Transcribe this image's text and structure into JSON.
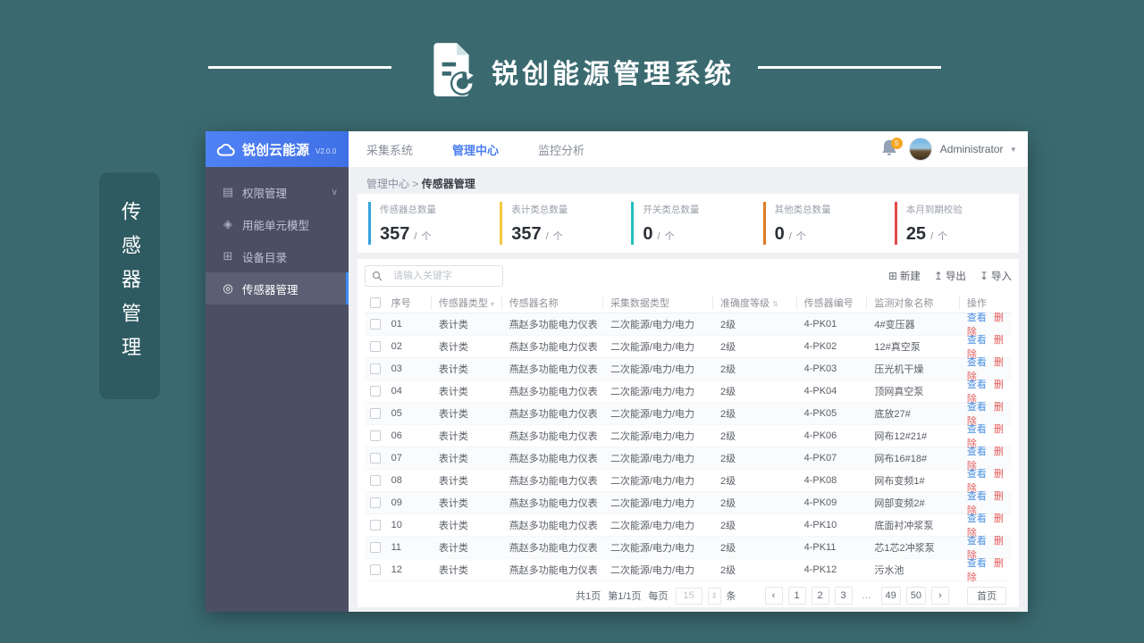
{
  "banner": {
    "title": "锐创能源管理系统"
  },
  "side_tab": {
    "label": "传感器管理"
  },
  "sidebar": {
    "logo_name": "锐创云能源",
    "logo_version": "V2.0.0",
    "items": [
      {
        "label": "权限管理",
        "glyph": "▤",
        "icon": "permission-icon",
        "expandable": true,
        "active": false
      },
      {
        "label": "用能单元模型",
        "glyph": "◈",
        "icon": "energy-unit-icon",
        "active": false
      },
      {
        "label": "设备目录",
        "glyph": "⊞",
        "icon": "device-catalog-icon",
        "active": false
      },
      {
        "label": "传感器管理",
        "glyph": "◎",
        "icon": "sensor-icon",
        "active": true
      }
    ]
  },
  "topnav": {
    "items": [
      {
        "label": "采集系统",
        "active": false
      },
      {
        "label": "管理中心",
        "active": true
      },
      {
        "label": "监控分析",
        "active": false
      }
    ],
    "badge": "5",
    "user": "Administrator",
    "caret": "▾"
  },
  "breadcrumb": {
    "parent": "管理中心",
    "separator": ">",
    "current": "传感器管理"
  },
  "stats": [
    {
      "label": "传感器总数量",
      "value": "357",
      "slash": "/",
      "unit": "个",
      "color": "#36A3DC"
    },
    {
      "label": "表计类总数量",
      "value": "357",
      "slash": "/",
      "unit": "个",
      "color": "#F0C83C"
    },
    {
      "label": "开关类总数量",
      "value": "0",
      "slash": "/",
      "unit": "个",
      "color": "#25BEBE"
    },
    {
      "label": "其他类总数量",
      "value": "0",
      "slash": "/",
      "unit": "个",
      "color": "#E07B26"
    },
    {
      "label": "本月到期校验",
      "value": "25",
      "slash": "/",
      "unit": "个",
      "color": "#E24A4A"
    }
  ],
  "toolbar": {
    "search_placeholder": "请输入关键字",
    "new_label": "新建",
    "new_glyph": "⊞",
    "export_label": "导出",
    "export_glyph": "↥",
    "import_label": "导入",
    "import_glyph": "↧"
  },
  "table": {
    "headers": {
      "no": "序号",
      "type": "传感器类型",
      "name": "传感器名称",
      "data_type": "采集数据类型",
      "accuracy": "准确度等级",
      "code": "传感器编号",
      "target": "监测对象名称",
      "actions": "操作"
    },
    "filter_glyph": "▾",
    "sort_glyph": "⇅",
    "view_label": "查看",
    "delete_label": "删除",
    "rows": [
      {
        "no": "01",
        "type": "表计类",
        "name": "燕赵多功能电力仪表",
        "data_type": "二次能源/电力/电力",
        "accuracy": "2级",
        "code": "4-PK01",
        "target": "4#变压器"
      },
      {
        "no": "02",
        "type": "表计类",
        "name": "燕赵多功能电力仪表",
        "data_type": "二次能源/电力/电力",
        "accuracy": "2级",
        "code": "4-PK02",
        "target": "12#真空泵"
      },
      {
        "no": "03",
        "type": "表计类",
        "name": "燕赵多功能电力仪表",
        "data_type": "二次能源/电力/电力",
        "accuracy": "2级",
        "code": "4-PK03",
        "target": "压光机干燥"
      },
      {
        "no": "04",
        "type": "表计类",
        "name": "燕赵多功能电力仪表",
        "data_type": "二次能源/电力/电力",
        "accuracy": "2级",
        "code": "4-PK04",
        "target": "顶网真空泵"
      },
      {
        "no": "05",
        "type": "表计类",
        "name": "燕赵多功能电力仪表",
        "data_type": "二次能源/电力/电力",
        "accuracy": "2级",
        "code": "4-PK05",
        "target": "底放27#"
      },
      {
        "no": "06",
        "type": "表计类",
        "name": "燕赵多功能电力仪表",
        "data_type": "二次能源/电力/电力",
        "accuracy": "2级",
        "code": "4-PK06",
        "target": "网布12#21#"
      },
      {
        "no": "07",
        "type": "表计类",
        "name": "燕赵多功能电力仪表",
        "data_type": "二次能源/电力/电力",
        "accuracy": "2级",
        "code": "4-PK07",
        "target": "网布16#18#"
      },
      {
        "no": "08",
        "type": "表计类",
        "name": "燕赵多功能电力仪表",
        "data_type": "二次能源/电力/电力",
        "accuracy": "2级",
        "code": "4-PK08",
        "target": "网布变频1#"
      },
      {
        "no": "09",
        "type": "表计类",
        "name": "燕赵多功能电力仪表",
        "data_type": "二次能源/电力/电力",
        "accuracy": "2级",
        "code": "4-PK09",
        "target": "网部变频2#"
      },
      {
        "no": "10",
        "type": "表计类",
        "name": "燕赵多功能电力仪表",
        "data_type": "二次能源/电力/电力",
        "accuracy": "2级",
        "code": "4-PK10",
        "target": "底面衬冲浆泵"
      },
      {
        "no": "11",
        "type": "表计类",
        "name": "燕赵多功能电力仪表",
        "data_type": "二次能源/电力/电力",
        "accuracy": "2级",
        "code": "4-PK11",
        "target": "芯1芯2冲浆泵"
      },
      {
        "no": "12",
        "type": "表计类",
        "name": "燕赵多功能电力仪表",
        "data_type": "二次能源/电力/电力",
        "accuracy": "2级",
        "code": "4-PK12",
        "target": "污水池"
      }
    ]
  },
  "pagination": {
    "total": "共1页",
    "current": "第1/1页",
    "per_page_label": "每页",
    "per_page_value": "15",
    "unit": "条",
    "prev": "‹",
    "next": "›",
    "home": "首页",
    "pages": [
      {
        "label": "1"
      },
      {
        "label": "2"
      },
      {
        "label": "3"
      },
      {
        "label": "…",
        "ellipsis": true
      },
      {
        "label": "49"
      },
      {
        "label": "50"
      }
    ]
  }
}
